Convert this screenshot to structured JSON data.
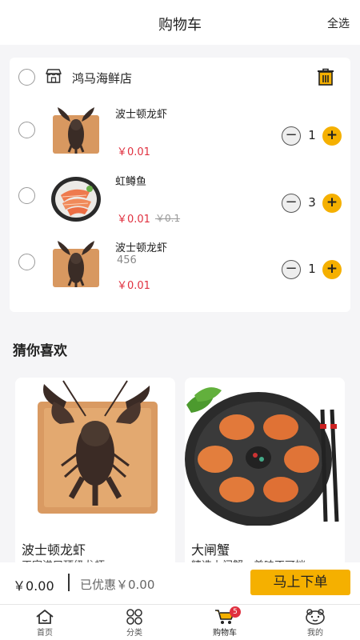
{
  "header": {
    "title": "购物车",
    "select_all": "全选"
  },
  "shop": {
    "name": "鸿马海鲜店"
  },
  "items": [
    {
      "name": "波士顿龙虾",
      "price": "￥0.01",
      "quantity": "1"
    },
    {
      "name": "虹鳟鱼",
      "price": "￥0.01",
      "old_price": "￥0.1",
      "quantity": "3"
    },
    {
      "name": "波士顿龙虾",
      "spec": "456",
      "price": "￥0.01",
      "quantity": "1"
    }
  ],
  "stepper": {
    "minus": "−",
    "plus": "+"
  },
  "guess": {
    "title": "猜你喜欢",
    "products": [
      {
        "name": "波士顿龙虾",
        "desc": "正宗进口顶级龙虾"
      },
      {
        "name": "大闸蟹",
        "desc": "精选上门蟹，美味不可挡"
      }
    ]
  },
  "checkout": {
    "total": "￥0.00",
    "discount": "已优惠￥0.00",
    "button": "马上下单"
  },
  "tabbar": [
    {
      "label": "首页",
      "icon": "home-icon"
    },
    {
      "label": "分类",
      "icon": "category-icon"
    },
    {
      "label": "购物车",
      "icon": "cart-icon",
      "badge": "5"
    },
    {
      "label": "我的",
      "icon": "profile-icon"
    }
  ],
  "colors": {
    "accent": "#f5b000",
    "price": "#e0303f",
    "background": "#f5f5f7"
  }
}
